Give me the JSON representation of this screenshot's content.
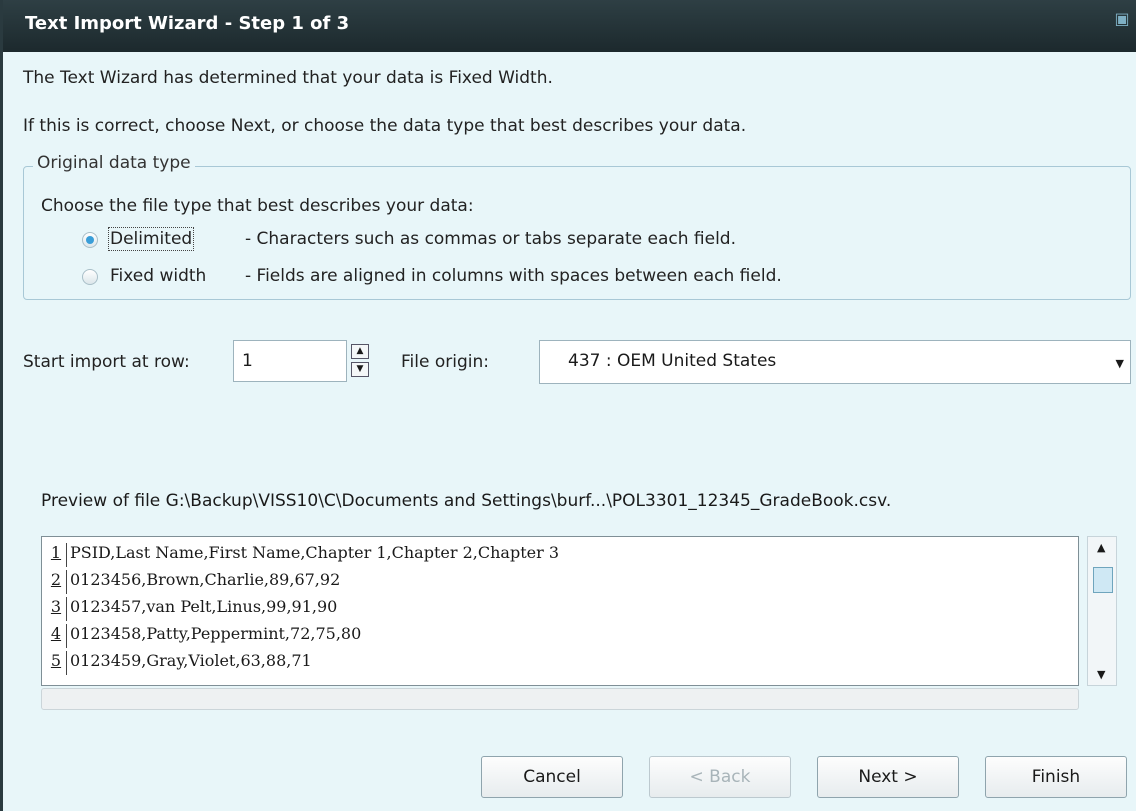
{
  "window": {
    "title": "Text Import Wizard - Step 1 of 3",
    "corner_icon": "restore-icon"
  },
  "intro": {
    "line1": "The Text Wizard has determined that your data is Fixed Width.",
    "line2": "If this is correct, choose Next, or choose the data type that best describes your data."
  },
  "original_data_type": {
    "legend": "Original data type",
    "prompt": "Choose the file type that best describes your data:",
    "options": [
      {
        "label": "Delimited",
        "description": "- Characters such as commas or tabs separate each field.",
        "checked": true
      },
      {
        "label": "Fixed width",
        "description": "- Fields are aligned in columns with spaces between each field.",
        "checked": false
      }
    ]
  },
  "start_row": {
    "label": "Start import at row:",
    "value": "1"
  },
  "file_origin": {
    "label": "File origin:",
    "value": "437 : OEM United States"
  },
  "preview": {
    "label": "Preview of file G:\\Backup\\VISS10\\C\\Documents and Settings\\burf...\\POL3301_12345_GradeBook.csv.",
    "rows": [
      {
        "num": "1",
        "text": "PSID,Last Name,First Name,Chapter 1,Chapter 2,Chapter 3"
      },
      {
        "num": "2",
        "text": "0123456,Brown,Charlie,89,67,92"
      },
      {
        "num": "3",
        "text": "0123457,van Pelt,Linus,99,91,90"
      },
      {
        "num": "4",
        "text": "0123458,Patty,Peppermint,72,75,80"
      },
      {
        "num": "5",
        "text": "0123459,Gray,Violet,63,88,71"
      }
    ]
  },
  "buttons": {
    "cancel": "Cancel",
    "back": "< Back",
    "next": "Next >",
    "finish": "Finish"
  },
  "colors": {
    "accent": "#3a9ed8",
    "dialog_bg": "#e8f6f9",
    "titlebar": "#1c292d"
  }
}
